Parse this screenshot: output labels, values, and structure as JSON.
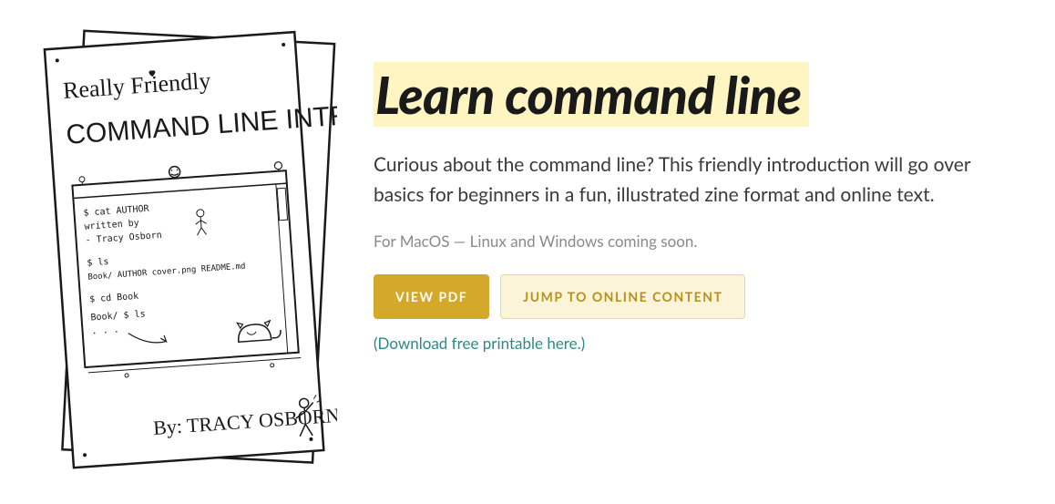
{
  "cover": {
    "title_line1": "Really Friendly",
    "title_line2": "COMMAND LINE INTRO",
    "terminal_lines": [
      "$ cat AUTHOR",
      "written by",
      "- Tracy Osborn",
      "$ ls",
      "Book/  AUTHOR  cover.png  README.md",
      "$ cd Book",
      "Book/ $ ls",
      ". . ."
    ],
    "byline": "By: TRACY OSBORN"
  },
  "headline": "Learn command line",
  "description": "Curious about the command line? This friendly introduction will go over basics for beginners in a fun, illustrated zine format and online text.",
  "platform_note": "For MacOS — Linux and Windows coming soon.",
  "buttons": {
    "primary": "VIEW PDF",
    "secondary": "JUMP TO ONLINE CONTENT"
  },
  "download_link": "(Download free printable here.)"
}
